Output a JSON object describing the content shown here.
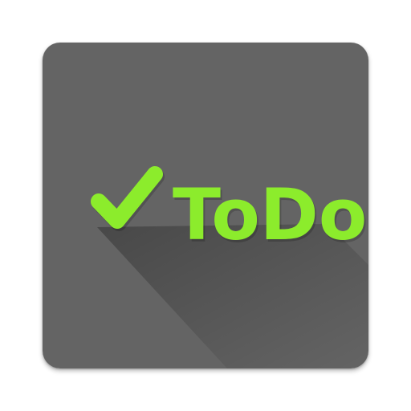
{
  "app": {
    "name": "ToDo",
    "background_color": "#646464",
    "accent_color": "#8cec2c",
    "icon": "checkmark-icon"
  }
}
